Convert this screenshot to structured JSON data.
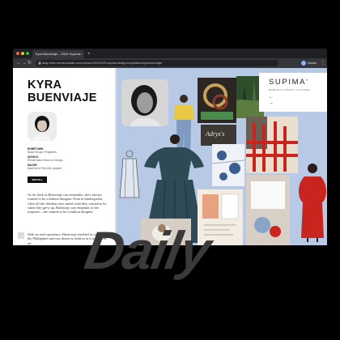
{
  "browser": {
    "tab_title": "Kyra Buenviaje – 2020 Supima",
    "tab_close": "×",
    "new_tab": "+",
    "url": "daily-fresh-memes.fatdair.com/supima-2020/2020-supima-design-competition/kyra-buenviaje/",
    "profile_label": "Guest",
    "nav_back": "←",
    "nav_forward": "→",
    "nav_reload": "↻",
    "menu": "⋮"
  },
  "designer": {
    "name_line1": "KYRA",
    "name_line2": "BUENVIAJE",
    "meta": [
      {
        "label": "HOMETOWN",
        "value": "Baton Rouge, Philippines"
      },
      {
        "label": "SCHOOL",
        "value": "Rhode Island School of Design"
      },
      {
        "label": "MAJOR",
        "value": "Bachelor of Fine Arts, Apparel"
      }
    ],
    "watch_button": "WATCH ▸",
    "bio_p1": "As far back as Buenviaje can remember, she's always wanted to be a fashion designer. Even in kindergarten, when all the children were asked what they wanted to be when they grew up, Buenviaje was emphatic in her response – she wanted to be a fashion designer.",
    "bio_p2": "With no real experience, Buenviaje enrolled in college in the Philippines and was drawn to fashion as a way of the art."
  },
  "brand": {
    "name": "SUPIMA",
    "registered": "®",
    "tagline": "WORLD'S FINEST COTTONS",
    "prev_arrow": "←",
    "next_arrow": "→"
  },
  "mood_board": {
    "swatch_text": "Adrys's"
  },
  "overlay": {
    "logo": "Daily"
  },
  "colors": {
    "board_bg": "#b8c9e6",
    "gown": "#2e4a55",
    "red_dress": "#c8251f",
    "chrome": "#35363a"
  }
}
